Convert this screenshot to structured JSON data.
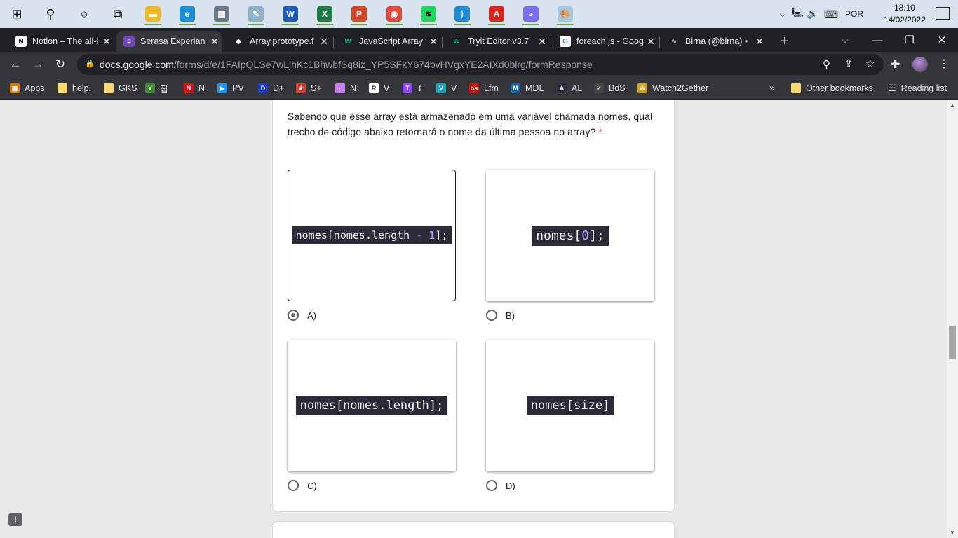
{
  "taskbar": {
    "pinned": [
      {
        "name": "windows-start-icon",
        "symbol": "⊞",
        "color": "#0a0a0a",
        "bg": "transparent"
      },
      {
        "name": "search-icon",
        "symbol": "⚲",
        "color": "#0a0a0a",
        "bg": "transparent"
      },
      {
        "name": "cortana-icon",
        "symbol": "○",
        "color": "#0a0a0a",
        "bg": "transparent"
      },
      {
        "name": "task-view-icon",
        "symbol": "⧉",
        "color": "#0a0a0a",
        "bg": "transparent"
      },
      {
        "name": "file-explorer-icon",
        "symbol": "▬",
        "color": "#fff",
        "bg": "#f2b822"
      },
      {
        "name": "edge-icon",
        "symbol": "e",
        "color": "#fff",
        "bg": "#1b8fd6"
      },
      {
        "name": "calculator-icon",
        "symbol": "▦",
        "color": "#fff",
        "bg": "#6c7a86"
      },
      {
        "name": "notepad-icon",
        "symbol": "✎",
        "color": "#fff",
        "bg": "#8fb3c9"
      },
      {
        "name": "word-icon",
        "symbol": "W",
        "color": "#fff",
        "bg": "#1e5bb8"
      },
      {
        "name": "excel-icon",
        "symbol": "X",
        "color": "#fff",
        "bg": "#1d7a45"
      },
      {
        "name": "powerpoint-icon",
        "symbol": "P",
        "color": "#fff",
        "bg": "#d24625"
      },
      {
        "name": "chrome-icon",
        "symbol": "◉",
        "color": "#fff",
        "bg": "#e04a3c"
      },
      {
        "name": "spotify-icon",
        "symbol": "≋",
        "color": "#111",
        "bg": "#1ed760"
      },
      {
        "name": "vscode-icon",
        "symbol": "⟩",
        "color": "#fff",
        "bg": "#1f8ad2"
      },
      {
        "name": "acrobat-icon",
        "symbol": "A",
        "color": "#fff",
        "bg": "#d7261e"
      },
      {
        "name": "discord-icon",
        "symbol": "◕",
        "color": "#fff",
        "bg": "#7a6df0"
      },
      {
        "name": "paint-icon",
        "symbol": "🎨",
        "color": "#fff",
        "bg": "#a3c8e4"
      }
    ],
    "language": "POR",
    "time": "18:10",
    "date": "14/02/2022"
  },
  "tabs": [
    {
      "title": "Notion – The all-i",
      "fav": "N",
      "fav_bg": "#ffffff",
      "fav_color": "#000"
    },
    {
      "title": "Serasa Experian T",
      "fav": "≡",
      "fav_bg": "#7248b9",
      "fav_color": "#fff",
      "active": true
    },
    {
      "title": "Array.prototype.f",
      "fav": "◆",
      "fav_bg": "#202124",
      "fav_color": "#fff"
    },
    {
      "title": "JavaScript Array f",
      "fav": "W",
      "fav_bg": "#202124",
      "fav_color": "#04aa6d"
    },
    {
      "title": "Tryit Editor v3.7",
      "fav": "W",
      "fav_bg": "#202124",
      "fav_color": "#04aa6d"
    },
    {
      "title": "foreach js - Goog",
      "fav": "G",
      "fav_bg": "#ffffff",
      "fav_color": "#4285f4"
    },
    {
      "title": "Birna (@birna) • ",
      "fav": "∿",
      "fav_bg": "#202124",
      "fav_color": "#aaa"
    }
  ],
  "toolbar": {
    "url_host": "docs.google.com",
    "url_path": "/forms/d/e/1FAIpQLSe7wLjhKc1BhwbfSq8iz_YP5SFkY674bvHVgxYE2AIXd0blrg/formResponse"
  },
  "bookmarks": [
    {
      "label": "Apps",
      "icon": "▦",
      "bg": "#e37400"
    },
    {
      "label": "help.",
      "icon": "",
      "bg": "#f8d775"
    },
    {
      "label": "GKS",
      "icon": "",
      "bg": "#f8d775"
    },
    {
      "label": "집",
      "icon": "Y",
      "bg": "#3c8a2e"
    },
    {
      "label": "N",
      "icon": "N",
      "bg": "#e50914"
    },
    {
      "label": "PV",
      "icon": "▶",
      "bg": "#1a98ff"
    },
    {
      "label": "D+",
      "icon": "D",
      "bg": "#113ccf"
    },
    {
      "label": "S+",
      "icon": "★",
      "bg": "#d93a2b"
    },
    {
      "label": "N",
      "icon": "◐",
      "bg": "#c77dff"
    },
    {
      "label": "V",
      "icon": "R",
      "bg": "#ffffff"
    },
    {
      "label": "T",
      "icon": "T",
      "bg": "#9146ff"
    },
    {
      "label": "V",
      "icon": "V",
      "bg": "#17a2b8"
    },
    {
      "label": "Lfm",
      "icon": "os",
      "bg": "#d51007"
    },
    {
      "label": "MDL",
      "icon": "M",
      "bg": "#1c64a8"
    },
    {
      "label": "AL",
      "icon": "A",
      "bg": "#2b2d42"
    },
    {
      "label": "BdS",
      "icon": "✓",
      "bg": "#444"
    },
    {
      "label": "Watch2Gether",
      "icon": "W",
      "bg": "#d6a31a"
    }
  ],
  "other_bookmarks": "Other bookmarks",
  "reading_list": "Reading list",
  "form": {
    "question": "Sabendo que esse array está armazenado em uma variável chamada nomes, qual trecho de código abaixo retornará o nome da última pessoa no array?",
    "required_mark": "*",
    "options": [
      {
        "label": "A)",
        "code_a": "nomes[nomes.length ",
        "code_op": "-",
        "code_num": " 1",
        "code_b": "];",
        "selected": true
      },
      {
        "label": "B)",
        "code_a": "nomes[",
        "code_num": "0",
        "code_b": "];",
        "selected": false
      },
      {
        "label": "C)",
        "code_a": "nomes[nomes.length];",
        "selected": false
      },
      {
        "label": "D)",
        "code_a": "nomes[size]",
        "selected": false
      }
    ]
  }
}
